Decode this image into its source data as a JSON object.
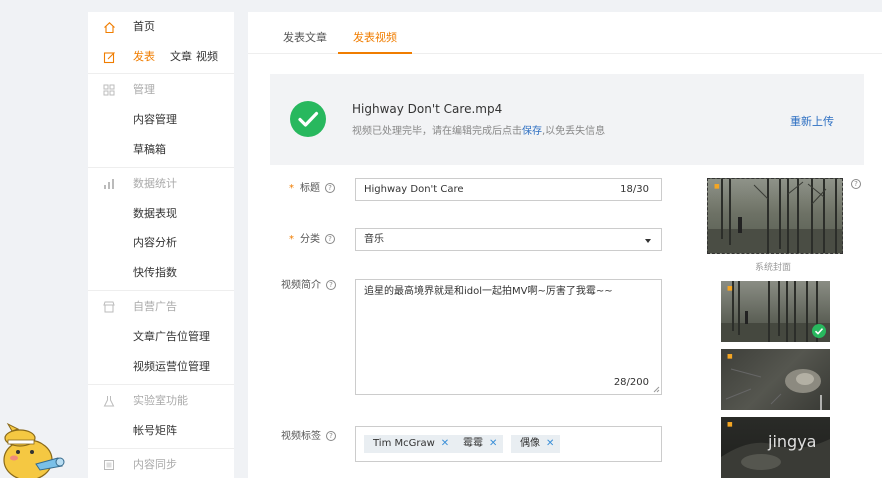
{
  "sidebar": {
    "home": "首页",
    "publish": {
      "label": "发表",
      "article": "文章",
      "video": "视频"
    },
    "manage": {
      "label": "管理",
      "items": [
        "内容管理",
        "草稿箱"
      ]
    },
    "stats": {
      "label": "数据统计",
      "items": [
        "数据表现",
        "内容分析",
        "快传指数"
      ]
    },
    "ads": {
      "label": "自营广告",
      "items": [
        "文章广告位管理",
        "视频运营位管理"
      ]
    },
    "lab": {
      "label": "实验室功能",
      "items": [
        "帐号矩阵"
      ]
    },
    "sync": {
      "label": "内容同步"
    }
  },
  "tabs": [
    "发表文章",
    "发表视频"
  ],
  "upload": {
    "file_name": "Highway Don't Care.mp4",
    "note_prefix": "视频已处理完毕，请在编辑完成后点击",
    "note_link": "保存",
    "note_suffix": ",以免丢失信息",
    "reupload": "重新上传"
  },
  "form": {
    "title": {
      "label": "标题",
      "value": "Highway Don't Care",
      "count": "18/30"
    },
    "category": {
      "label": "分类",
      "value": "音乐"
    },
    "intro": {
      "label": "视频简介",
      "value": "追星的最高境界就是和idol一起拍MV啊~厉害了我霉~~",
      "count": "28/200"
    },
    "tags": {
      "label": "视频标签",
      "items": [
        "Tim McGraw",
        "霉霉",
        "偶像"
      ]
    }
  },
  "cover": {
    "system_label": "系统封面",
    "help": "?"
  },
  "watermark": "jingya",
  "colors": {
    "accent": "#f07d00",
    "success": "#28b85e",
    "link": "#2d6fc2"
  }
}
